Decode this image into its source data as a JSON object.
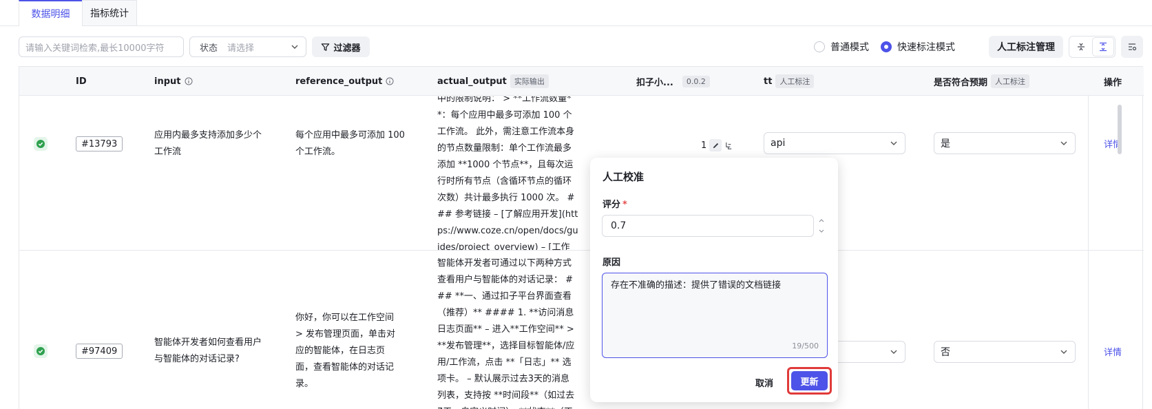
{
  "tabs": [
    {
      "label": "数据明细",
      "active": true
    },
    {
      "label": "指标统计",
      "active": false
    }
  ],
  "toolbar": {
    "search_placeholder": "请输入关键词检索,最长10000字符",
    "status_label": "状态",
    "status_placeholder": "请选择",
    "filter_label": "过滤器",
    "mode_normal": "普通模式",
    "mode_fast": "快速标注模式",
    "selected_mode": "快速标注模式",
    "manage_label": "人工标注管理"
  },
  "columns": {
    "id": "ID",
    "input": "input",
    "reference_output": "reference_output",
    "actual_output": "actual_output",
    "actual_output_tag": "实际输出",
    "kouzi": "扣子小...",
    "kouzi_tag": "0.0.2",
    "tt": "tt",
    "tt_tag": "人工标注",
    "expected": "是否符合预期",
    "expected_tag": "人工标注",
    "ops": "操作"
  },
  "rows": [
    {
      "id": "#13793",
      "input": "应用内最多支持添加多少个工作流",
      "reference_output": "每个应用中最多可添加 100 个工作流。",
      "actual_output": "中的限制说明： > **工作流数量**：每个应用中最多可添加 100 个工作流。 此外，需注意工作流本身的节点数量限制：单个工作流最多添加 **1000 个节点**，且每次运行时所有节点（含循环节点的循环次数）共计最多执行 1000 次。 ### 参考链接 – [了解应用开发](https://www.coze.cn/open/docs/guides/project_overview) – [工作流",
      "score": "1",
      "tt": "api",
      "expected": "是",
      "detail": "详情"
    },
    {
      "id": "#97409",
      "input": "智能体开发者如何查看用户与智能体的对话记录?",
      "reference_output": "你好，你可以在工作空间 > 发布管理页面，单击对应的智能体，在日志页面，查看智能体的对话记录。",
      "actual_output": "智能体开发者可通过以下两种方式查看用户与智能体的对话记录： ### **一、通过扣子平台界面查看（推荐）** #### 1. **访问消息日志页面** – 进入**工作空间** > **发布管理**，选择目标智能体/应用/工作流，点击 **「日志」** 选项卡。 – 默认展示过去3天的消息列表，支持按 **时间段**（如过去7天、自定义时间）、**状态**（正",
      "expected": "否",
      "detail": "详情"
    }
  ],
  "popover": {
    "title": "人工校准",
    "score_label": "评分",
    "score_value": "0.7",
    "reason_label": "原因",
    "reason_value": "存在不准确的描述：提供了错误的文档链接",
    "counter": "19/500",
    "cancel_label": "取消",
    "update_label": "更新"
  },
  "colors": {
    "accent": "#4d53e8",
    "highlight": "#e03a3a",
    "success": "#2fa14f"
  }
}
